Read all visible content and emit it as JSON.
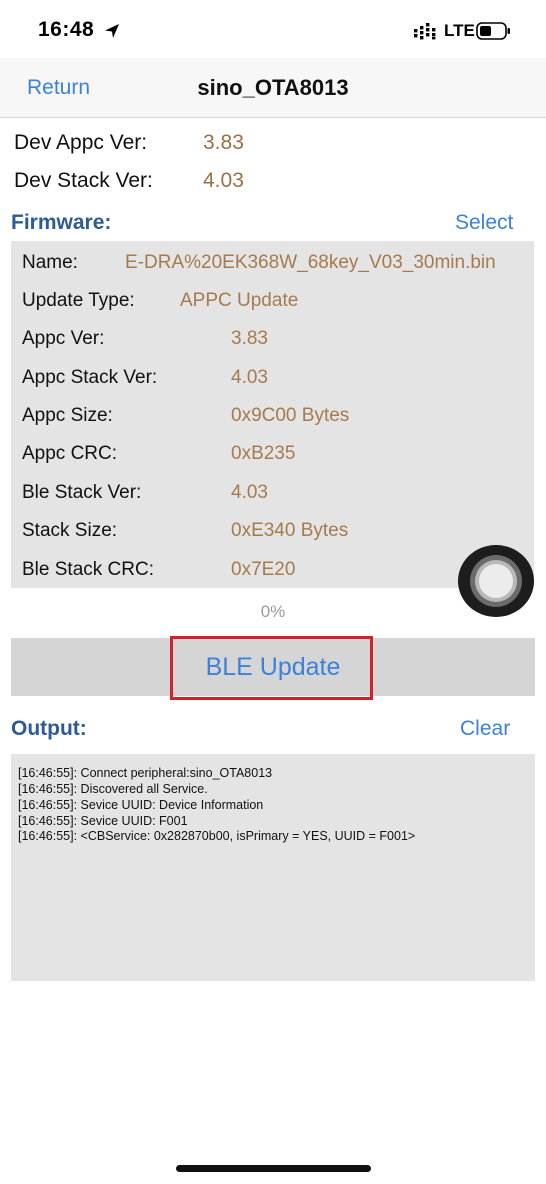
{
  "status_bar": {
    "time": "16:48",
    "network": "LTE",
    "icons": [
      "location-arrow-icon",
      "signal-bars-icon",
      "battery-icon"
    ]
  },
  "nav": {
    "back_label": "Return",
    "title": "sino_OTA8013"
  },
  "device": {
    "appc_ver_label": "Dev Appc Ver:",
    "appc_ver_value": "3.83",
    "stack_ver_label": "Dev Stack Ver:",
    "stack_ver_value": "4.03"
  },
  "firmware": {
    "title": "Firmware:",
    "select_label": "Select",
    "rows": [
      {
        "label": "Name:",
        "value": "E-DRA%20EK368W_68key_V03_30min.bin"
      },
      {
        "label": "Update Type:",
        "value": "APPC Update"
      },
      {
        "label": "Appc Ver:",
        "value": "3.83"
      },
      {
        "label": "Appc Stack Ver:",
        "value": "4.03"
      },
      {
        "label": "Appc Size:",
        "value": "0x9C00 Bytes"
      },
      {
        "label": "Appc CRC:",
        "value": "0xB235"
      },
      {
        "label": "Ble Stack Ver:",
        "value": "4.03"
      },
      {
        "label": "Stack Size:",
        "value": "0xE340 Bytes"
      },
      {
        "label": "Ble Stack CRC:",
        "value": "0x7E20"
      }
    ]
  },
  "progress_text": "0%",
  "ble_update_label": "BLE Update",
  "output": {
    "title": "Output:",
    "clear_label": "Clear",
    "log": [
      "[16:46:55]: Connect peripheral:sino_OTA8013",
      "[16:46:55]: Discovered all Service.",
      "[16:46:55]: Sevice UUID: Device Information",
      "[16:46:55]: Sevice UUID: F001",
      "[16:46:55]: <CBService: 0x282870b00, isPrimary = YES, UUID = F001>"
    ]
  },
  "colors": {
    "accent_blue": "#3c82d8",
    "section_title": "#2c5c93",
    "value_brown": "#9a7046",
    "highlight_red": "#d4202a"
  }
}
